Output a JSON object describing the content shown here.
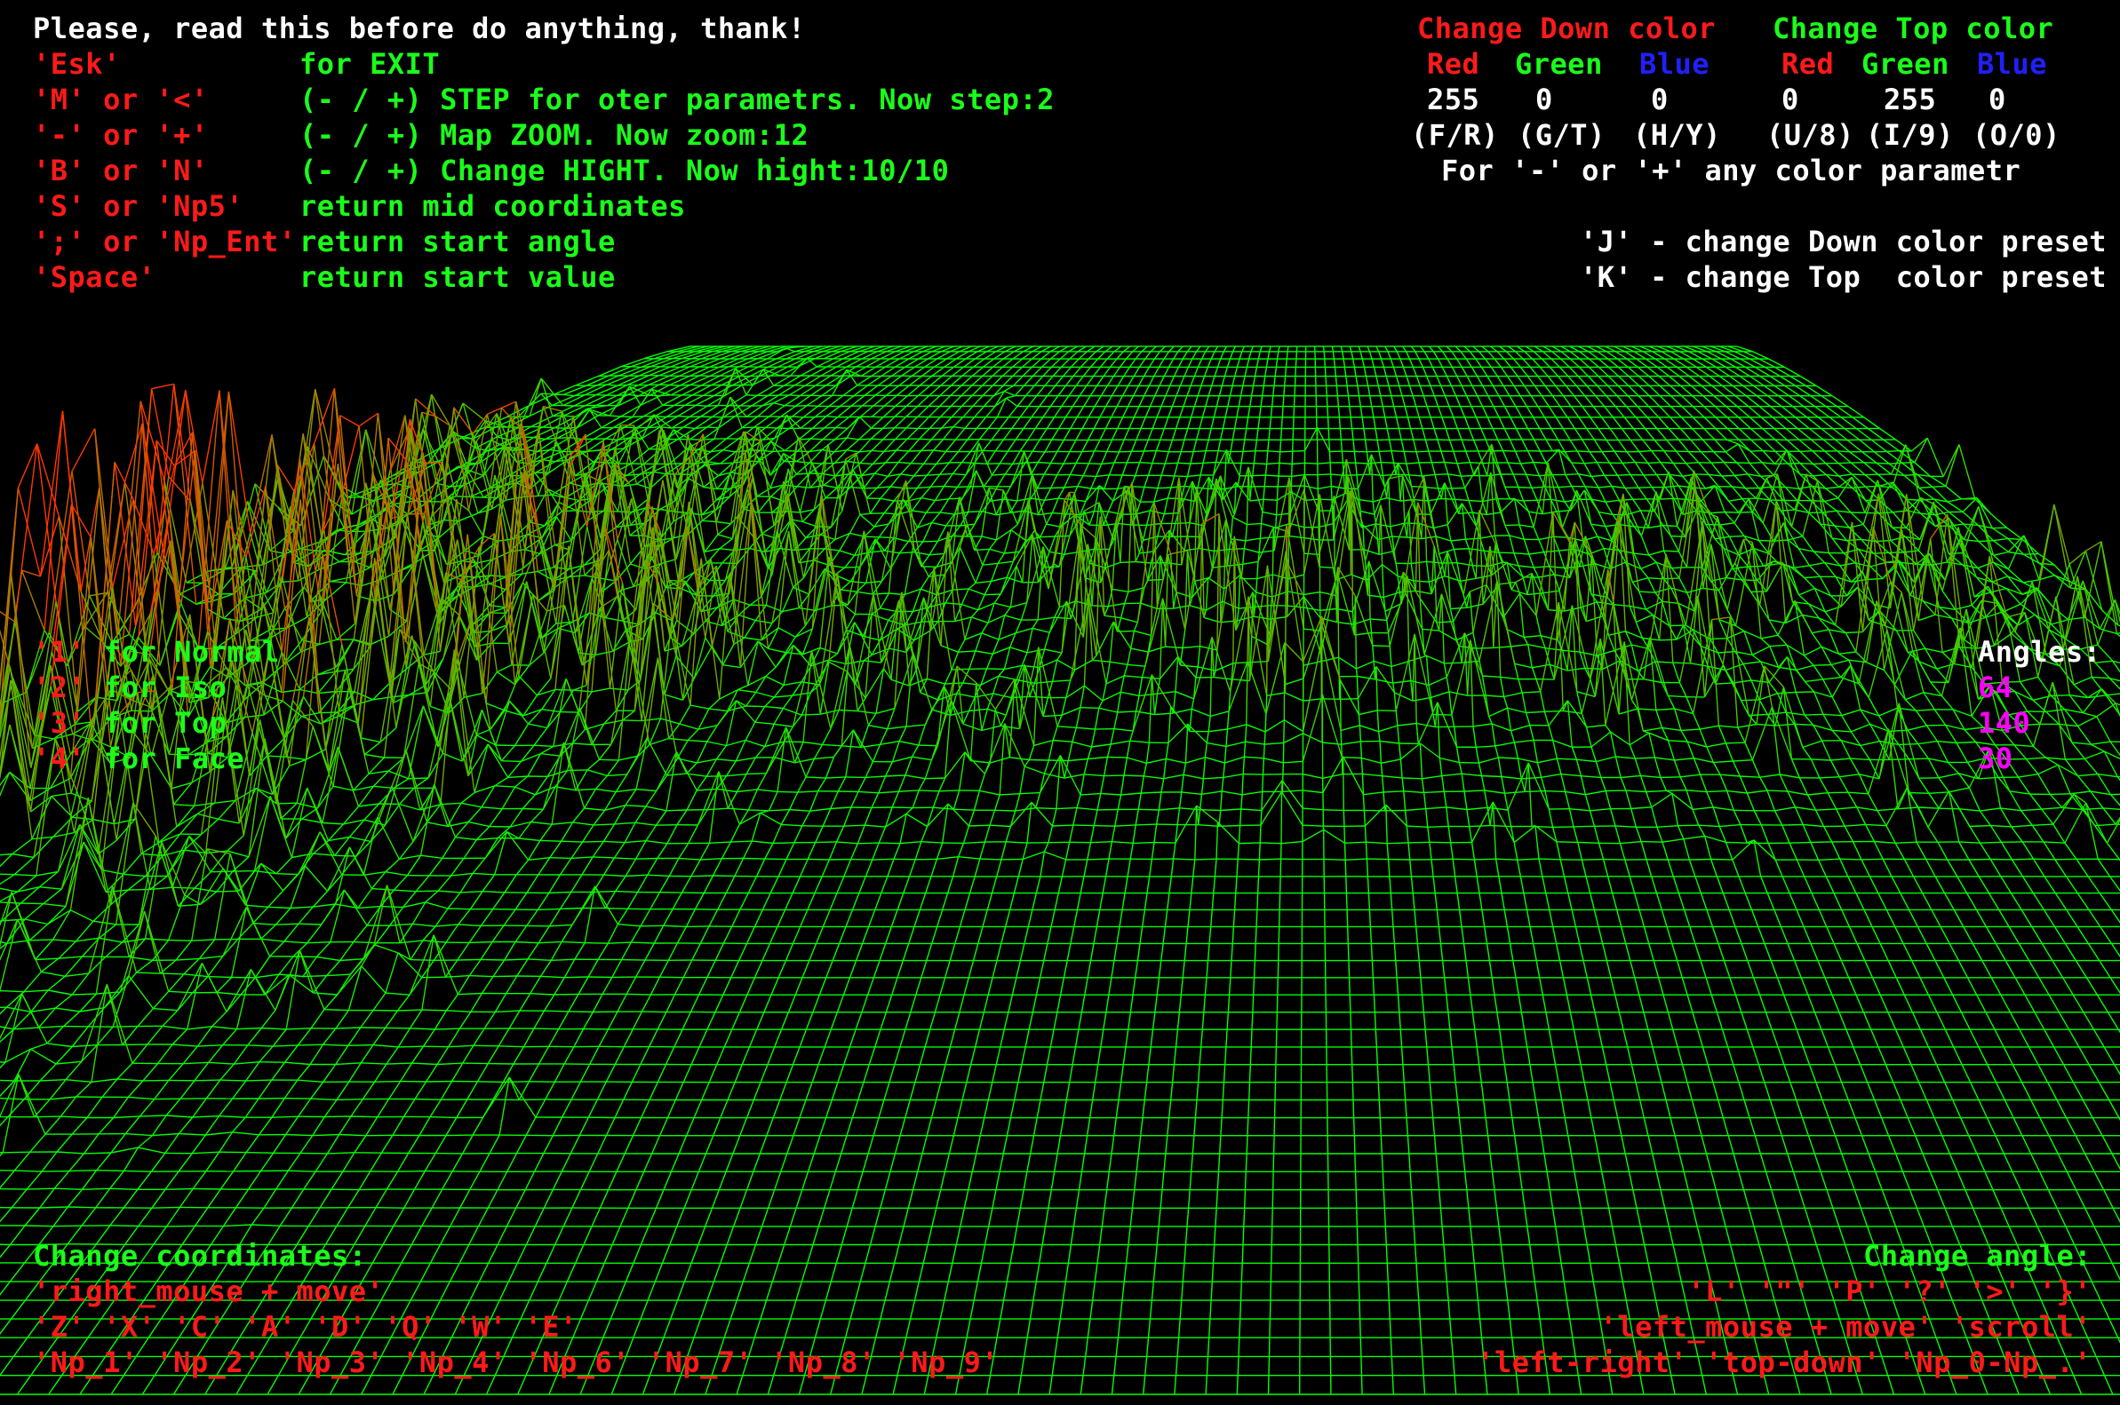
{
  "colors": {
    "background": "#000000",
    "text_white": "#ffffff",
    "text_red": "#ff1a1a",
    "text_green": "#1aff1a",
    "text_blue": "#2020ff",
    "text_magenta": "#ff00ff",
    "mesh_down": "#ff0000",
    "mesh_top": "#00ff00"
  },
  "help": {
    "intro": "Please, read this before do anything, thank!",
    "rows": [
      {
        "key": "'Esk'",
        "desc": "for EXIT"
      },
      {
        "key": "'M' or '<'",
        "desc": "(- / +) STEP for oter parametrs. Now step:2"
      },
      {
        "key": "'-' or '+'",
        "desc": "(- / +) Map ZOOM. Now zoom:12"
      },
      {
        "key": "'B' or 'N'",
        "desc": "(- / +) Change HIGHT. Now hight:10/10"
      },
      {
        "key": "'S' or 'Np5'",
        "desc": "return mid coordinates"
      },
      {
        "key": "';' or 'Np_Ent'",
        "desc": "return start angle"
      },
      {
        "key": "'Space'",
        "desc": "return start value"
      }
    ]
  },
  "color_panel": {
    "down_title": "Change Down color",
    "top_title": "Change Top color",
    "channels": [
      "Red",
      "Green",
      "Blue"
    ],
    "down_values": [
      "255",
      "0",
      "0"
    ],
    "top_values": [
      "0",
      "255",
      "0"
    ],
    "down_keys": [
      "(F/R)",
      "(G/T)",
      "(H/Y)"
    ],
    "top_keys": [
      "(U/8)",
      "(I/9)",
      "(O/0)"
    ],
    "hint": "For '-' or '+' any color parametr",
    "preset_down": "'J' - change Down color preset",
    "preset_top": "'K' - change Top  color preset"
  },
  "views": [
    {
      "key": "'1'",
      "label": "for Normal"
    },
    {
      "key": "'2'",
      "label": "for Iso"
    },
    {
      "key": "'3'",
      "label": "for Top"
    },
    {
      "key": "'4'",
      "label": "for Face"
    }
  ],
  "angles": {
    "title": "Angles:",
    "values": [
      "64",
      "140",
      "30"
    ]
  },
  "coords_help": {
    "title": "Change coordinates:",
    "lines": [
      "'right_mouse + move'",
      "'Z' 'X' 'C' 'A' 'D' 'Q' 'W' 'E'",
      "'Np_1' 'Np_2' 'Np_3' 'Np_4' 'Np_6' 'Np_7' 'Np_8' 'Np_9'"
    ]
  },
  "angle_help": {
    "title": "Change angle:",
    "lines": [
      "'L' '\"' 'P' '?' '>' '}'",
      "'left_mouse + move' 'scroll'",
      "'left-right' 'top-down' 'Np_0-Np_.'"
    ]
  }
}
